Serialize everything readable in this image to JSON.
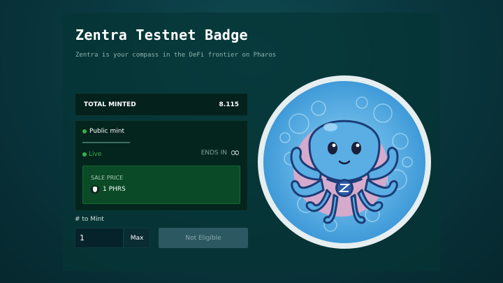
{
  "header": {
    "title": "Zentra Testnet Badge",
    "subtitle": "Zentra is your compass in the DeFi frontier on Pharos"
  },
  "stats": {
    "total_minted_label": "TOTAL MINTED",
    "total_minted_value": "8.115"
  },
  "phase": {
    "tab_label": "Public mint",
    "status": "Live",
    "ends_label": "ENDS IN",
    "ends_value": "∞",
    "sale_price_label": "SALE PRICE",
    "sale_price_value": "1 PHRS",
    "token_icon": "pharos-token-icon"
  },
  "mint": {
    "quantity_label": "# to Mint",
    "quantity_value": "1",
    "max_label": "Max",
    "mint_button_label": "Not Eligible"
  },
  "badge": {
    "image": "octopus-badge-icon"
  },
  "colors": {
    "live_green": "#38b04d",
    "price_box": "#0a4a26",
    "disabled_button": "#2c5862"
  }
}
